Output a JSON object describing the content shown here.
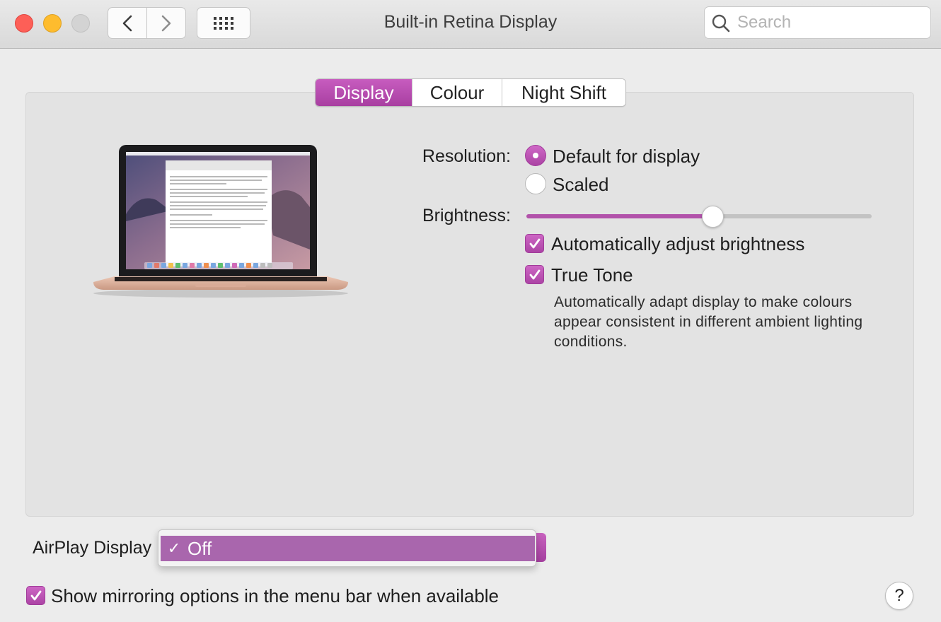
{
  "window": {
    "title": "Built-in Retina Display"
  },
  "toolbar": {
    "back_icon": "chevron-left-icon",
    "forward_icon": "chevron-right-icon",
    "grid_icon": "show-all-grid-icon"
  },
  "search": {
    "placeholder": "Search",
    "value": ""
  },
  "tabs": [
    {
      "label": "Display",
      "active": true
    },
    {
      "label": "Colour",
      "active": false
    },
    {
      "label": "Night Shift",
      "active": false
    }
  ],
  "display": {
    "resolution_label": "Resolution:",
    "resolution_options": [
      {
        "label": "Default for display",
        "selected": true
      },
      {
        "label": "Scaled",
        "selected": false
      }
    ],
    "brightness_label": "Brightness:",
    "brightness_level": 0.54,
    "auto_brightness": {
      "label": "Automatically adjust brightness",
      "checked": true
    },
    "true_tone": {
      "label": "True Tone",
      "checked": true,
      "description": "Automatically adapt display to make colours appear consistent in different ambient lighting conditions."
    }
  },
  "airplay": {
    "label": "AirPlay Display",
    "menu_items": [
      {
        "label": "Off",
        "checked": true
      }
    ]
  },
  "mirroring": {
    "label": "Show mirroring options in the menu bar when available",
    "checked": true
  },
  "help": {
    "label": "?"
  },
  "colors": {
    "accent": "#b04aa8",
    "menu_highlight": "#a966ad",
    "window_bg": "#ececec"
  }
}
